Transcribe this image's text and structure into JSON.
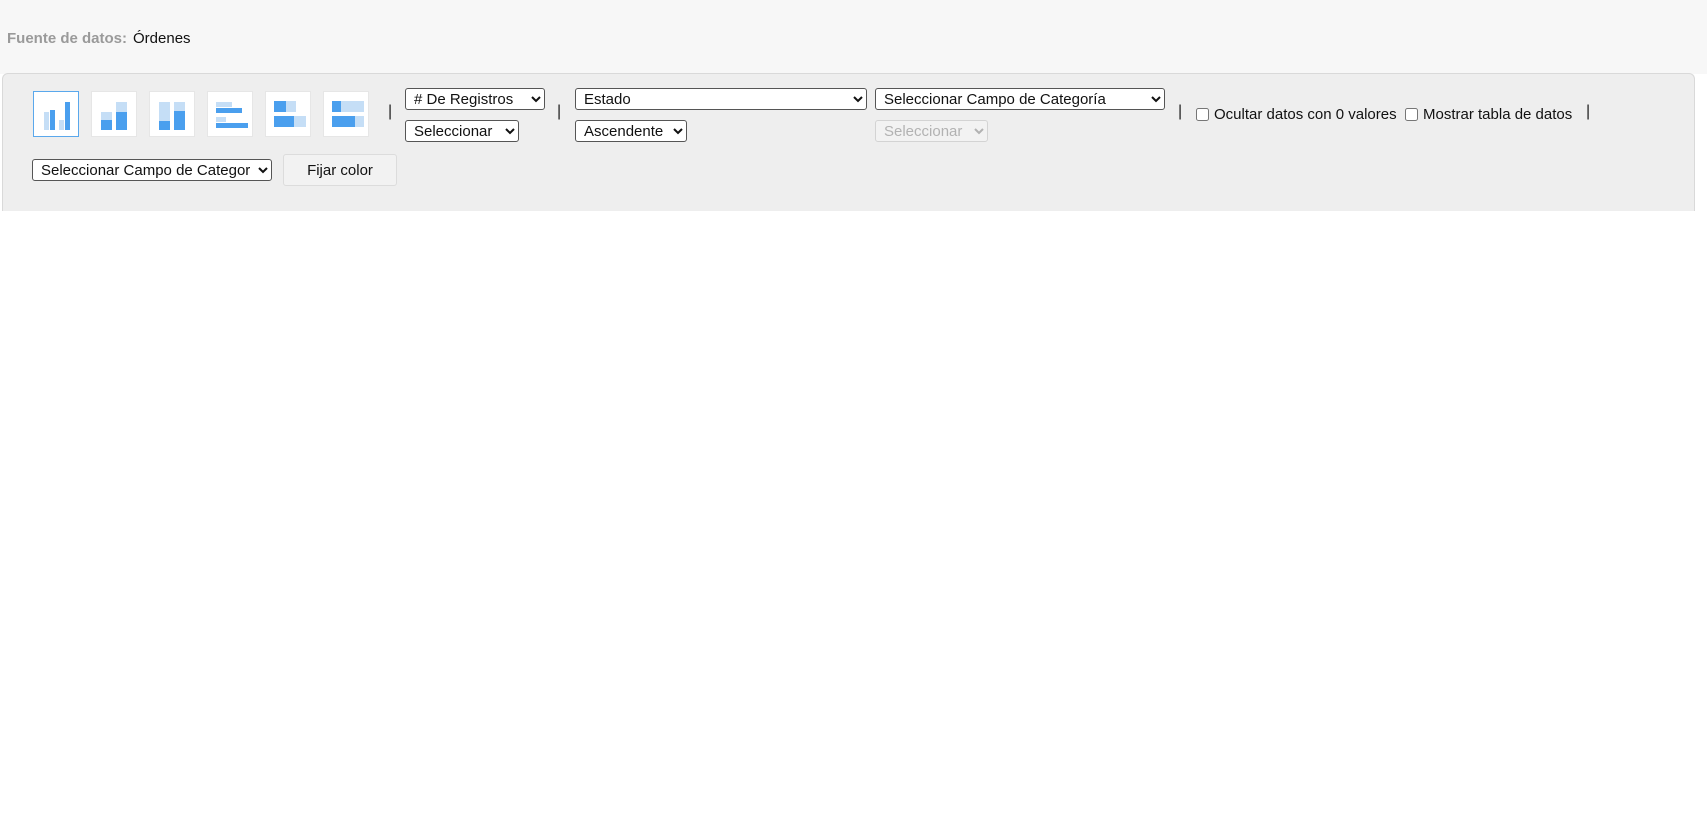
{
  "data_source": {
    "label": "Fuente de datos:",
    "value": "Órdenes"
  },
  "chart_types": [
    {
      "name": "vertical-bar",
      "active": true
    },
    {
      "name": "vertical-stacked-bar",
      "active": false
    },
    {
      "name": "vertical-100-stacked-bar",
      "active": false
    },
    {
      "name": "horizontal-bar",
      "active": false
    },
    {
      "name": "horizontal-stacked-bar",
      "active": false
    },
    {
      "name": "horizontal-100-stacked-bar",
      "active": false
    }
  ],
  "separator": "|",
  "measure": {
    "value": "# De Registros",
    "aggregation": "Seleccionar"
  },
  "group": {
    "value": "Estado",
    "sort": "Ascendente"
  },
  "category": {
    "value": "Seleccionar Campo de Categoría",
    "sub": "Seleccionar",
    "sub_disabled": true
  },
  "options": {
    "hide_zero": {
      "label": "Ocultar datos con 0 valores",
      "checked": false
    },
    "show_table": {
      "label": "Mostrar tabla de datos",
      "checked": false
    }
  },
  "color_field": {
    "value": "Seleccionar Campo de Categoría"
  },
  "fix_color_button": "Fijar color",
  "colors": {
    "bar_dark": "#4a9fee",
    "bar_light": "#c5def6",
    "accent": "#5aa8ec"
  }
}
